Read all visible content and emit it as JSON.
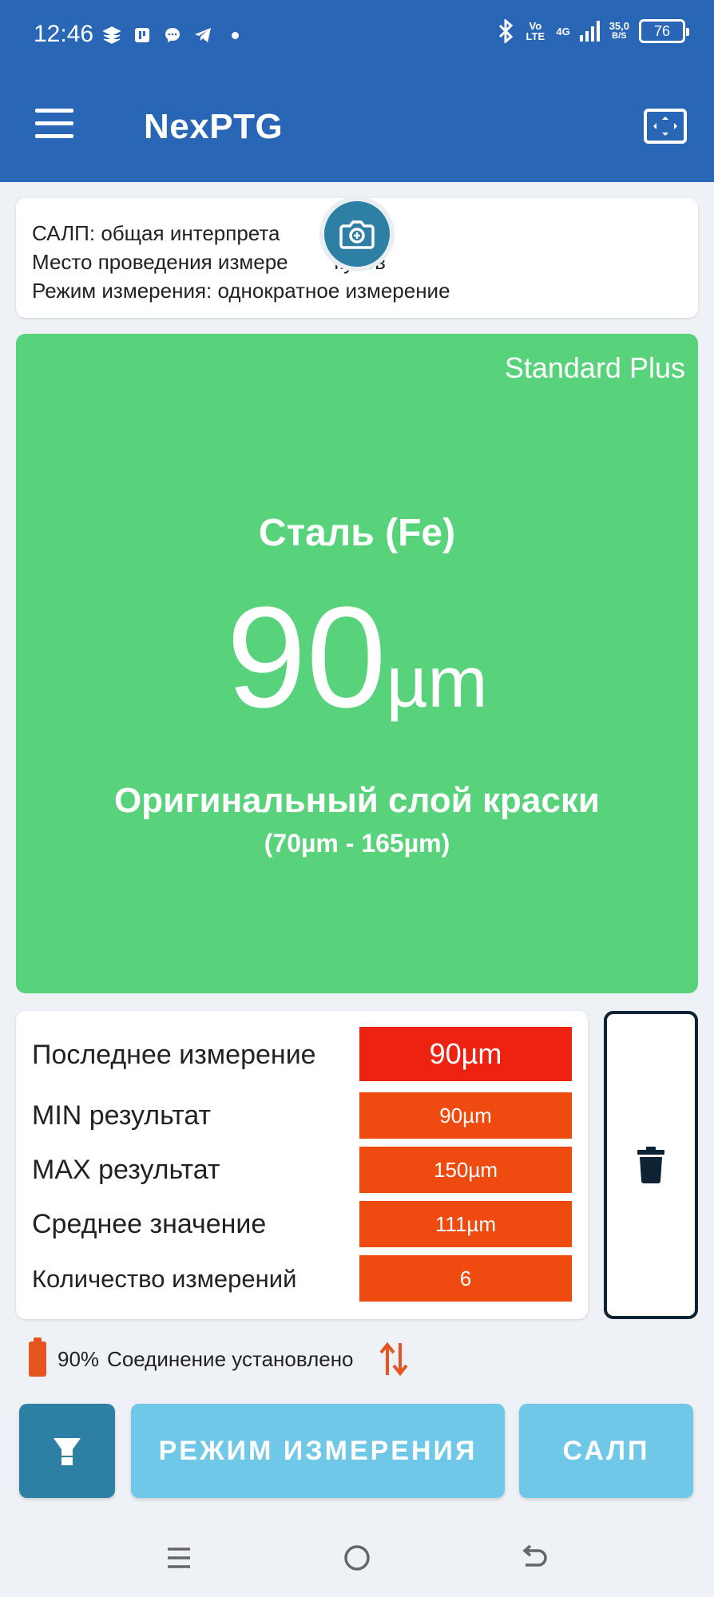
{
  "status_bar": {
    "time": "12:46",
    "volte": "Vo LTE",
    "network": "4G",
    "speed_value": "35,0",
    "speed_unit": "B/S",
    "battery": "76"
  },
  "app_bar": {
    "title": "NexPTG"
  },
  "info": {
    "line1": "САЛП: общая интерпрета",
    "line2": "Место проведения измере        кузов",
    "line3": "Режим измерения: однократное измерение"
  },
  "result": {
    "device": "Standard Plus",
    "material": "Сталь (Fe)",
    "value": "90",
    "unit": "µm",
    "description": "Оригинальный слой краски",
    "range": "(70µm - 165µm)",
    "color": "#59d37b"
  },
  "stats": {
    "rows": [
      {
        "label": "Последнее измерение",
        "value": "90µm",
        "color": "#ee2211"
      },
      {
        "label": "MIN результат",
        "value": "90µm",
        "color": "#ef4b10"
      },
      {
        "label": "MAX результат",
        "value": "150µm",
        "color": "#ef4b10"
      },
      {
        "label": "Среднее значение",
        "value": "111µm",
        "color": "#ef4b10"
      },
      {
        "label": "Количество измерений",
        "value": "6",
        "color": "#ef4b10"
      }
    ]
  },
  "connection": {
    "battery": "90%",
    "status": "Соединение установлено"
  },
  "buttons": {
    "mode": "РЕЖИМ ИЗМЕРЕНИЯ",
    "salp": "САЛП"
  },
  "icons": {
    "menu": "menu-icon",
    "fit_screen": "fit-screen-icon",
    "camera": "camera-icon",
    "delete": "trash-icon",
    "probe": "probe-icon",
    "transfer": "transfer-arrows-icon"
  }
}
